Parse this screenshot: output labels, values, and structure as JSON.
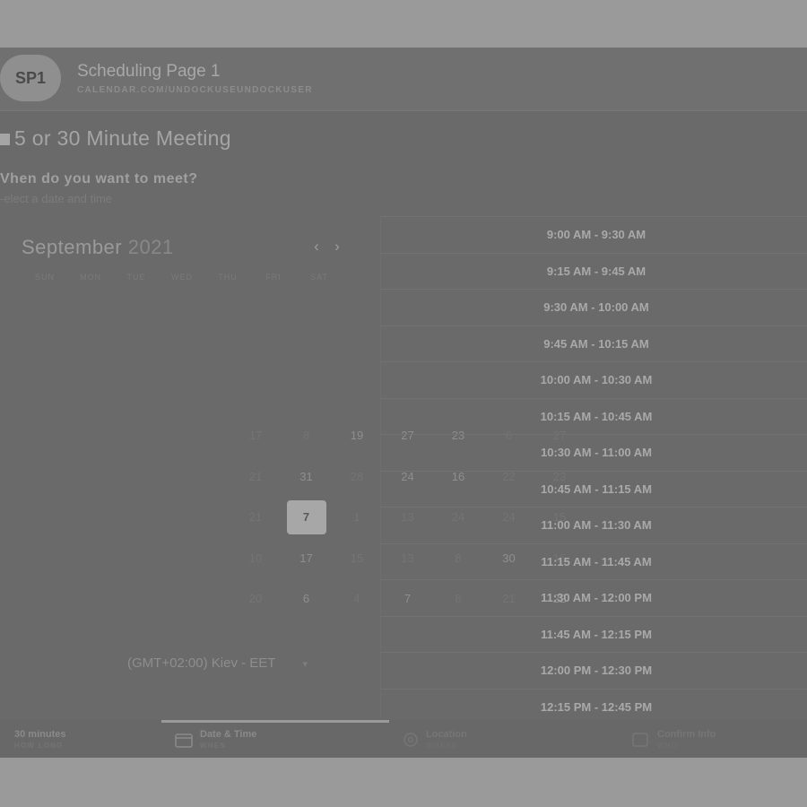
{
  "header": {
    "avatar_text": "SP1",
    "title": "Scheduling Page 1",
    "url": "CALENDAR.COM/UNDOCKUSEUNDOCKUSER"
  },
  "meeting": {
    "title": "5 or 30 Minute Meeting",
    "prompt": "Vhen do you want to meet?",
    "instruction": "-elect a date and time"
  },
  "calendar": {
    "month": "September",
    "year": "2021",
    "prev": "‹",
    "next": "›",
    "weekdays": [
      "SUN",
      "MON",
      "TUE",
      "WED",
      "THU",
      "FRI",
      "SAT"
    ],
    "days": [
      {
        "text": "17",
        "dim": true
      },
      {
        "text": "8",
        "dim": true
      },
      {
        "text": "19",
        "dim": false
      },
      {
        "text": "27",
        "dim": false
      },
      {
        "text": "23",
        "dim": false
      },
      {
        "text": "6",
        "dim": true
      },
      {
        "text": "27",
        "dim": true
      },
      {
        "text": "21",
        "dim": true
      },
      {
        "text": "31",
        "dim": false
      },
      {
        "text": "28",
        "dim": true
      },
      {
        "text": "24",
        "dim": false
      },
      {
        "text": "16",
        "dim": false
      },
      {
        "text": "22",
        "dim": true
      },
      {
        "text": "23",
        "dim": true
      },
      {
        "text": "21",
        "dim": true
      },
      {
        "text": "7",
        "dim": false,
        "selected": true
      },
      {
        "text": "1",
        "dim": true
      },
      {
        "text": "13",
        "dim": true
      },
      {
        "text": "24",
        "dim": true
      },
      {
        "text": "24",
        "dim": true
      },
      {
        "text": "15",
        "dim": true
      },
      {
        "text": "10",
        "dim": true
      },
      {
        "text": "17",
        "dim": false
      },
      {
        "text": "15",
        "dim": true
      },
      {
        "text": "13",
        "dim": true
      },
      {
        "text": "8",
        "dim": true
      },
      {
        "text": "30",
        "dim": false
      },
      {
        "text": "15",
        "dim": true
      },
      {
        "text": "20",
        "dim": true
      },
      {
        "text": "6",
        "dim": false
      },
      {
        "text": "4",
        "dim": true
      },
      {
        "text": "7",
        "dim": false
      },
      {
        "text": "8",
        "dim": true
      },
      {
        "text": "21",
        "dim": true
      },
      {
        "text": "22",
        "dim": false
      }
    ],
    "timezone": "(GMT+02:00) Kiev - EET",
    "timezone_caret": "▾"
  },
  "time_slots": [
    "9:00 AM - 9:30 AM",
    "9:15 AM - 9:45 AM",
    "9:30 AM - 10:00 AM",
    "9:45 AM - 10:15 AM",
    "10:00 AM - 10:30 AM",
    "10:15 AM - 10:45 AM",
    "10:30 AM - 11:00 AM",
    "10:45 AM - 11:15 AM",
    "11:00 AM - 11:30 AM",
    "11:15 AM - 11:45 AM",
    "11:30 AM - 12:00 PM",
    "11:45 AM - 12:15 PM",
    "12:00 PM - 12:30 PM",
    "12:15 PM - 12:45 PM"
  ],
  "footer": {
    "duration": {
      "main": "30 minutes",
      "sub": "HOW LONG"
    },
    "datetime": {
      "main": "Date & Time",
      "sub": "WHEN",
      "icon": "calendar-icon"
    },
    "location": {
      "main": "Location",
      "sub": "WHERE",
      "icon": "location-pin-icon"
    },
    "confirm": {
      "main": "Confirm Info",
      "sub": "WHO",
      "icon": "confirm-icon"
    }
  }
}
